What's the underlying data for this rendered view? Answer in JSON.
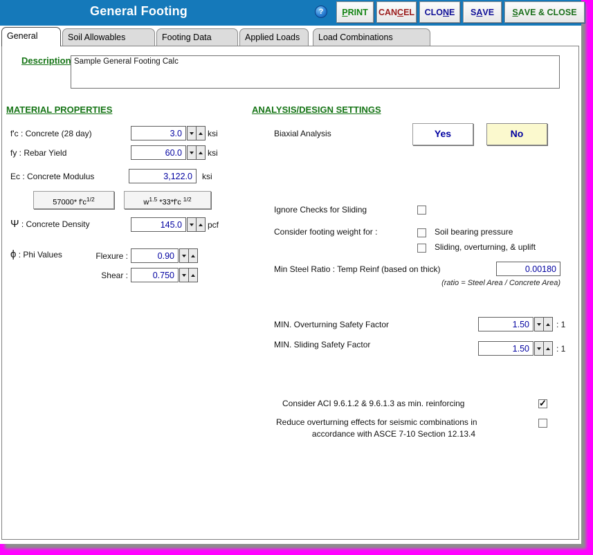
{
  "colors": {
    "title_bar_blue": "#1579BA",
    "header_green": "#157415",
    "value_navy": "#0000A0",
    "selected_yellow": "#FBF9CE",
    "transparency_magenta": "#FF00FF"
  },
  "title_bar": {
    "title": "General Footing",
    "help_glyph": "?",
    "buttons": [
      {
        "label": "PRINT",
        "underline_index": 0,
        "color": "#128312"
      },
      {
        "label": "CANCEL",
        "underline_index": 3,
        "color": "#9B1B1B"
      },
      {
        "label": "CLONE",
        "underline_index": 3,
        "color": "#101097"
      },
      {
        "label": "SAVE",
        "underline_index": 1,
        "color": "#101097"
      },
      {
        "label": "SAVE & CLOSE",
        "underline_index": 0,
        "color": "#1B6F1B"
      }
    ]
  },
  "tabs": [
    {
      "label": "General",
      "active": true
    },
    {
      "label": "Soil Allowables",
      "active": false
    },
    {
      "label": "Footing Data",
      "active": false
    },
    {
      "label": "Applied Loads",
      "active": false
    },
    {
      "label": "Load Combinations",
      "active": false
    }
  ],
  "description": {
    "label": "Description",
    "value": "Sample General Footing Calc"
  },
  "material": {
    "header": "MATERIAL PROPERTIES",
    "fc": {
      "label": "f'c : Concrete (28 day)",
      "value": "3.0",
      "unit": "ksi"
    },
    "fy": {
      "label": "fy : Rebar Yield",
      "value": "60.0",
      "unit": "ksi"
    },
    "ec": {
      "label": "Ec : Concrete Modulus",
      "value": "3,122.0",
      "unit": "ksi"
    },
    "formula1": {
      "base": "57000* f'c",
      "sup": "1/2"
    },
    "formula2": {
      "base1": "w",
      "sup1": "1.5",
      "base2": " *33*f'c ",
      "sup2": "1/2"
    },
    "density": {
      "symbol": "Ψ",
      "label": " : Concrete Density",
      "value": "145.0",
      "unit": "pcf"
    },
    "phi": {
      "symbol": "ϕ",
      "label": " : Phi Values",
      "flexure_label": "Flexure :",
      "flexure_value": "0.90",
      "shear_label": "Shear :",
      "shear_value": "0.750"
    }
  },
  "analysis": {
    "header": "ANALYSIS/DESIGN SETTINGS",
    "biaxial": {
      "label": "Biaxial Analysis",
      "yes_label": "Yes",
      "no_label": "No",
      "yes_selected": false,
      "no_selected": true
    },
    "ignore_sliding": {
      "label": "Ignore Checks for Sliding",
      "checked": false
    },
    "footing_weight": {
      "label": "Consider footing weight for :",
      "option1": {
        "label": "Soil bearing pressure",
        "checked": false
      },
      "option2": {
        "label": "Sliding, overturning, & uplift",
        "checked": false
      }
    },
    "min_steel_ratio": {
      "label": "Min Steel Ratio : Temp Reinf (based on thick)",
      "value": "0.00180",
      "note": "(ratio = Steel Area / Concrete Area)"
    },
    "overturning_sf": {
      "label": "MIN. Overturning Safety Factor",
      "value": "1.50",
      "suffix": ": 1"
    },
    "sliding_sf": {
      "label": "MIN. Sliding Safety Factor",
      "value": "1.50",
      "suffix": ": 1"
    },
    "aci_min_reinf": {
      "label": "Consider ACI 9.6.1.2 & 9.6.1.3 as min. reinforcing",
      "checked": true
    },
    "seismic_reduce": {
      "label_line1": "Reduce overturning effects for seismic combinations in",
      "label_line2": "accordance with ASCE 7-10 Section 12.13.4",
      "checked": false
    }
  }
}
